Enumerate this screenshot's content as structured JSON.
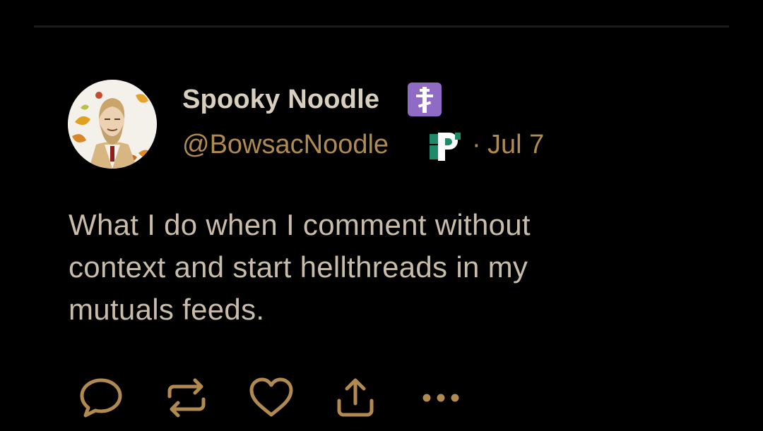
{
  "post": {
    "author": {
      "display_name": "Spooky Noodle",
      "handle": "@BowsacNoodle",
      "name_badge_icon": "orthodox-cross-icon",
      "handle_badge_icon": "letter-p-icon"
    },
    "separator": "·",
    "timestamp": "Jul 7",
    "text": "What I do when I comment without context and start hellthreads in my mutuals feeds."
  },
  "actions": [
    {
      "name": "reply",
      "icon": "speech-bubble-icon"
    },
    {
      "name": "repost",
      "icon": "repost-arrows-icon"
    },
    {
      "name": "like",
      "icon": "heart-icon"
    },
    {
      "name": "share",
      "icon": "share-upload-icon"
    },
    {
      "name": "more",
      "icon": "ellipsis-icon"
    }
  ],
  "colors": {
    "background": "#000000",
    "display_name": "#d8cfbd",
    "muted_gold": "#b08a4e",
    "body_text": "#c9bda9",
    "action_icon": "#b08a4e",
    "name_badge_bg": "#8f6bc6"
  }
}
